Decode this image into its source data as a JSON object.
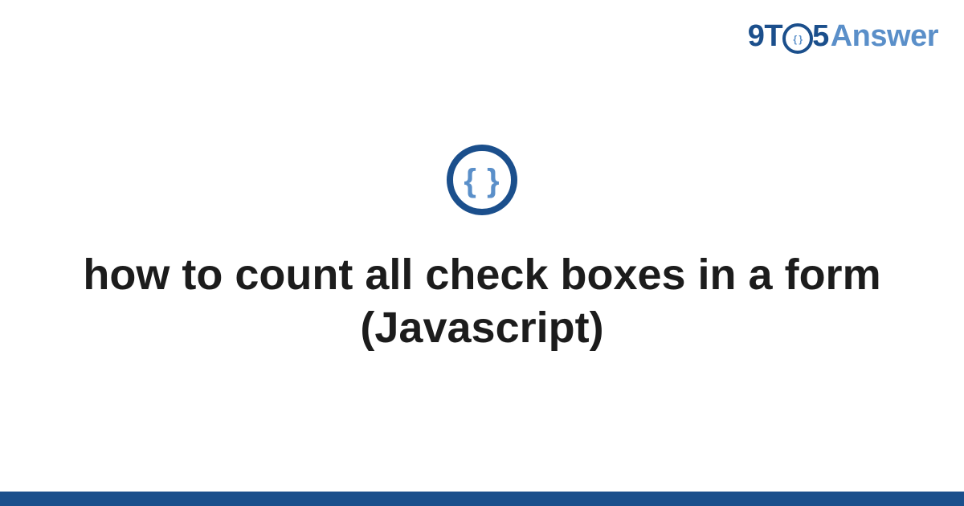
{
  "brand": {
    "part1": "9T",
    "part2": "5",
    "part3": "Answer",
    "colors": {
      "dark": "#1b4f8c",
      "light": "#5a8fc9"
    }
  },
  "icon": {
    "name": "code-braces-icon",
    "glyph": "{ }"
  },
  "title": "how to count all check boxes in a form (Javascript)"
}
